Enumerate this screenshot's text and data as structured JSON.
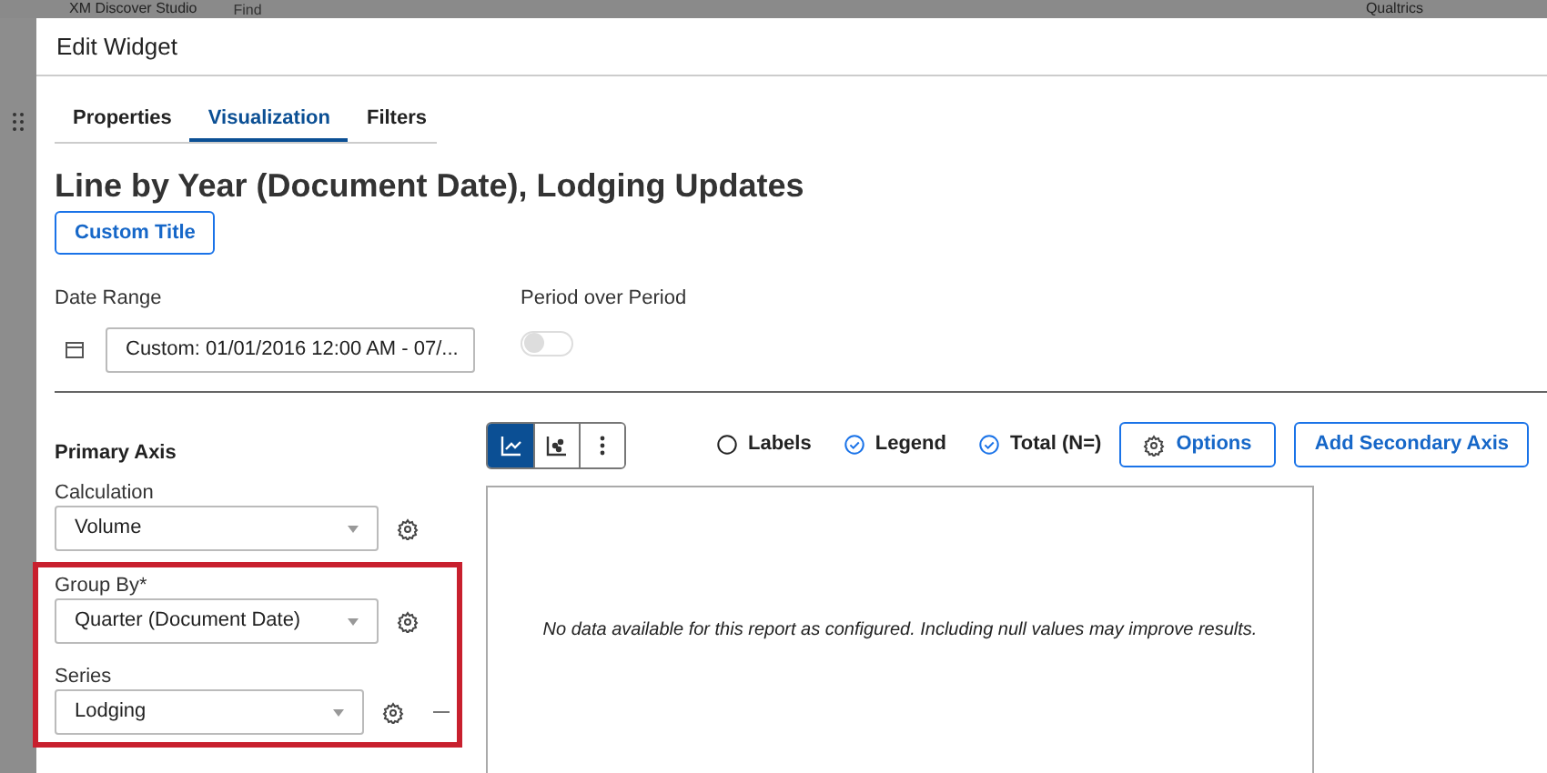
{
  "app_bar": {
    "title": "XM Discover Studio",
    "search": {
      "placeholder": "Find"
    },
    "brand": "Qualtrics"
  },
  "dialog": {
    "title": "Edit Widget"
  },
  "tabs": [
    {
      "label": "Properties",
      "selected": false
    },
    {
      "label": "Visualization",
      "selected": true
    },
    {
      "label": "Filters",
      "selected": false
    }
  ],
  "widget_title": "Line by Year (Document Date), Lodging Updates",
  "custom_title_button": "Custom Title",
  "date_range": {
    "label": "Date Range",
    "value": "Custom: 01/01/2016 12:00 AM - 07/..."
  },
  "period_over_period": {
    "label": "Period over Period",
    "on": false
  },
  "primary_axis": {
    "heading": "Primary Axis",
    "fields": [
      {
        "label": "Calculation",
        "value": "Volume",
        "removable": false
      }
    ],
    "highlighted_fields": [
      {
        "label": "Group By*",
        "value": "Quarter (Document Date)",
        "removable": false
      },
      {
        "label": "Series",
        "value": "Lodging",
        "removable": true
      }
    ]
  },
  "chart_types": [
    {
      "kind": "line",
      "selected": true
    },
    {
      "kind": "scatter",
      "selected": false
    },
    {
      "kind": "more",
      "selected": false
    }
  ],
  "chart_options": [
    {
      "label": "Labels",
      "checked": false
    },
    {
      "label": "Legend",
      "checked": true
    },
    {
      "label": "Total (N=)",
      "checked": true
    }
  ],
  "options_button": "Options",
  "secondary_axis_button": "Add Secondary Axis",
  "empty_message": "No data available for this report as configured. Including null values may improve results."
}
